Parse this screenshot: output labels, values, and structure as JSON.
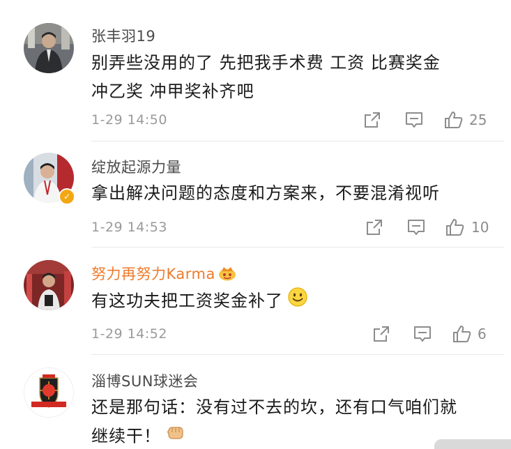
{
  "comments": [
    {
      "username": "张丰羽19",
      "text_lines": [
        "别弄些没用的了  先把我手术费  工资 比赛奖金",
        "冲乙奖  冲甲奖补齐吧"
      ],
      "time": "1-29 14:50",
      "likes": "25",
      "verified": false,
      "vip": false
    },
    {
      "username": "绽放起源力量",
      "text_lines": [
        "拿出解决问题的态度和方案来，不要混淆视听"
      ],
      "time": "1-29 14:53",
      "likes": "10",
      "verified": true,
      "vip": false
    },
    {
      "username": "努力再努力Karma",
      "text_lines": [
        "有这功夫把工资奖金补了"
      ],
      "time": "1-29 14:52",
      "likes": "6",
      "verified": false,
      "vip": true,
      "emoji": "smile-emoji"
    },
    {
      "username": "淄博SUN球迷会",
      "text_lines": [
        "还是那句话：没有过不去的坎，还有口气咱们就",
        "继续干！"
      ],
      "emoji": "fist-emoji"
    }
  ],
  "icons": [
    "share-icon",
    "comment-icon",
    "like-icon",
    "verified-badge-icon",
    "vip-crown-icon"
  ],
  "colors": {
    "username": "#4a4a4a",
    "vip_username": "#ee7b2c",
    "text": "#1a1a1a",
    "meta": "#9a9a9a",
    "icon": "#8c8c8c",
    "divider": "#e8e8e8",
    "badge": "#f3a712"
  }
}
